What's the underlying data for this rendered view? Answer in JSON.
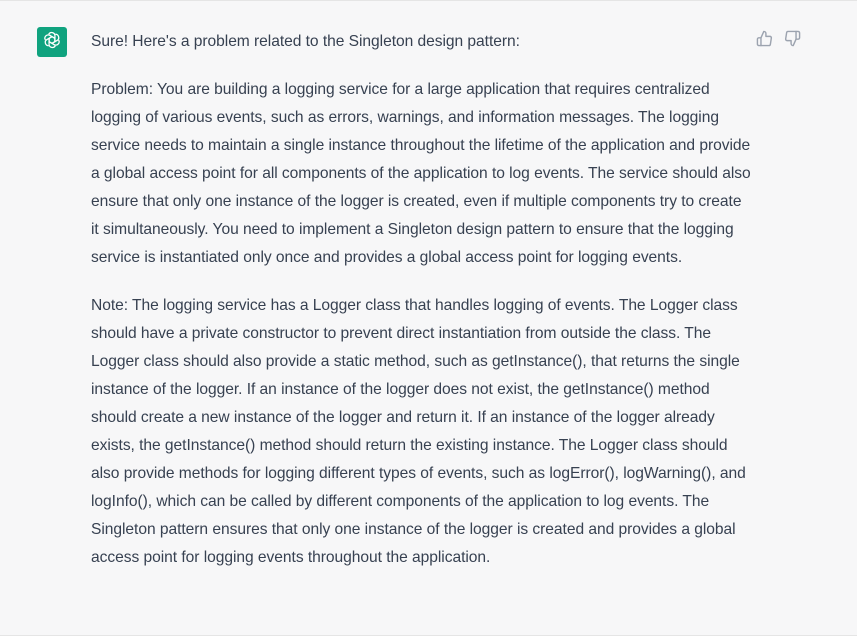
{
  "message": {
    "role": "assistant",
    "intro": "Sure! Here's a problem related to the Singleton design pattern:",
    "problem": "Problem: You are building a logging service for a large application that requires centralized logging of various events, such as errors, warnings, and information messages. The logging service needs to maintain a single instance throughout the lifetime of the application and provide a global access point for all components of the application to log events. The service should also ensure that only one instance of the logger is created, even if multiple components try to create it simultaneously. You need to implement a Singleton design pattern to ensure that the logging service is instantiated only once and provides a global access point for logging events.",
    "note": "Note: The logging service has a Logger class that handles logging of events. The Logger class should have a private constructor to prevent direct instantiation from outside the class. The Logger class should also provide a static method, such as getInstance(), that returns the single instance of the logger. If an instance of the logger does not exist, the getInstance() method should create a new instance of the logger and return it. If an instance of the logger already exists, the getInstance() method should return the existing instance. The Logger class should also provide methods for logging different types of events, such as logError(), logWarning(), and logInfo(), which can be called by different components of the application to log events. The Singleton pattern ensures that only one instance of the logger is created and provides a global access point for logging events throughout the application."
  },
  "avatar": {
    "icon": "openai-logo-icon",
    "color": "#10a37f"
  },
  "feedback": {
    "thumbs_up_icon": "thumbs-up-icon",
    "thumbs_down_icon": "thumbs-down-icon"
  },
  "colors": {
    "message_background": "#f7f7f8",
    "text": "#374151",
    "icon": "#9ca3af"
  }
}
